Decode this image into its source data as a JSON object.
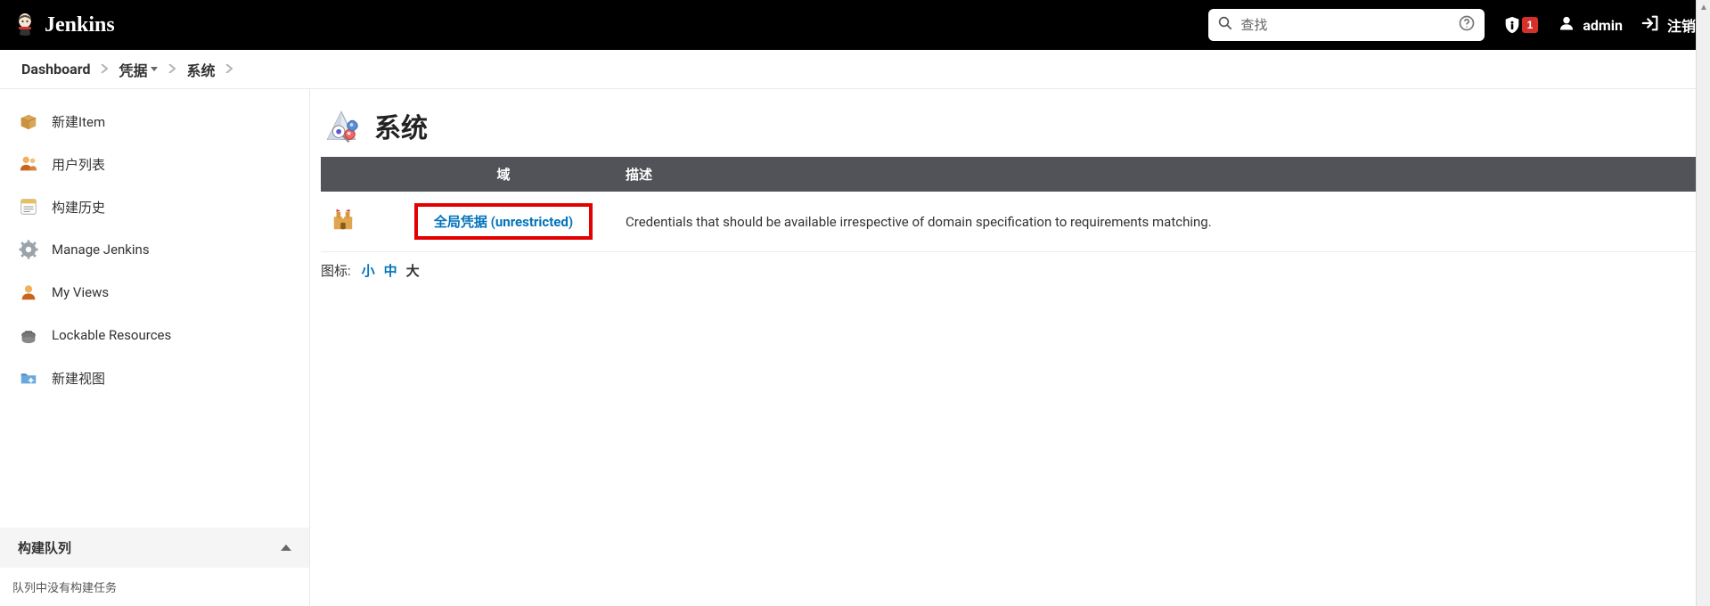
{
  "header": {
    "logo_text": "Jenkins",
    "search_placeholder": "查找",
    "notifications_count": "1",
    "user_name": "admin",
    "logout_label": "注销"
  },
  "breadcrumbs": [
    {
      "label": "Dashboard",
      "has_caret": false
    },
    {
      "label": "凭据",
      "has_caret": true
    },
    {
      "label": "系统",
      "has_caret": false
    }
  ],
  "sidebar": {
    "items": [
      {
        "label": "新建Item",
        "icon": "box-icon"
      },
      {
        "label": "用户列表",
        "icon": "users-icon"
      },
      {
        "label": "构建历史",
        "icon": "history-icon"
      },
      {
        "label": "Manage Jenkins",
        "icon": "gear-icon"
      },
      {
        "label": "My Views",
        "icon": "person-icon"
      },
      {
        "label": "Lockable Resources",
        "icon": "lock-icon"
      },
      {
        "label": "新建视图",
        "icon": "folder-plus-icon"
      }
    ],
    "queue_section": {
      "title": "构建队列",
      "empty_text": "队列中没有构建任务"
    }
  },
  "main": {
    "page_title": "系统",
    "table": {
      "columns": {
        "icon": "",
        "domain": "域",
        "description": "描述"
      },
      "rows": [
        {
          "domain_link": "全局凭据 (unrestricted)",
          "description": "Credentials that should be available irrespective of domain specification to requirements matching.",
          "highlighted": true
        }
      ]
    },
    "icon_size": {
      "label": "图标:",
      "options": [
        {
          "text": "小",
          "state": "link"
        },
        {
          "text": "中",
          "state": "link"
        },
        {
          "text": "大",
          "state": "active"
        }
      ]
    }
  },
  "colors": {
    "link": "#0073bb",
    "header_bg": "#000000",
    "table_head": "#525358",
    "highlight": "#e40000"
  }
}
